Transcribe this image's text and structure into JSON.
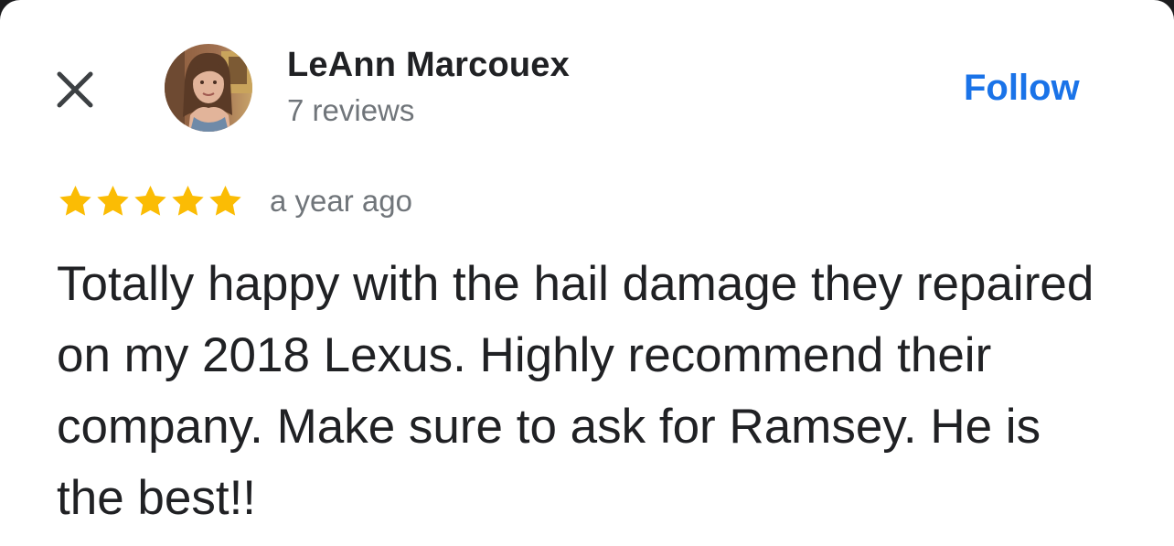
{
  "reviewer": {
    "name": "LeAnn Marcouex",
    "review_count": "7 reviews"
  },
  "actions": {
    "close_icon": "close-icon",
    "follow_label": "Follow"
  },
  "review": {
    "rating": 5,
    "rating_max": 5,
    "time_ago": "a year ago",
    "text": "Totally happy with the hail damage they repaired on my 2018 Lexus. Highly recommend their company. Make sure to ask for Ramsey. He is the best!!"
  },
  "colors": {
    "accent": "#1a73e8",
    "star": "#fbbc04",
    "text_primary": "#202124",
    "text_secondary": "#70757a"
  }
}
